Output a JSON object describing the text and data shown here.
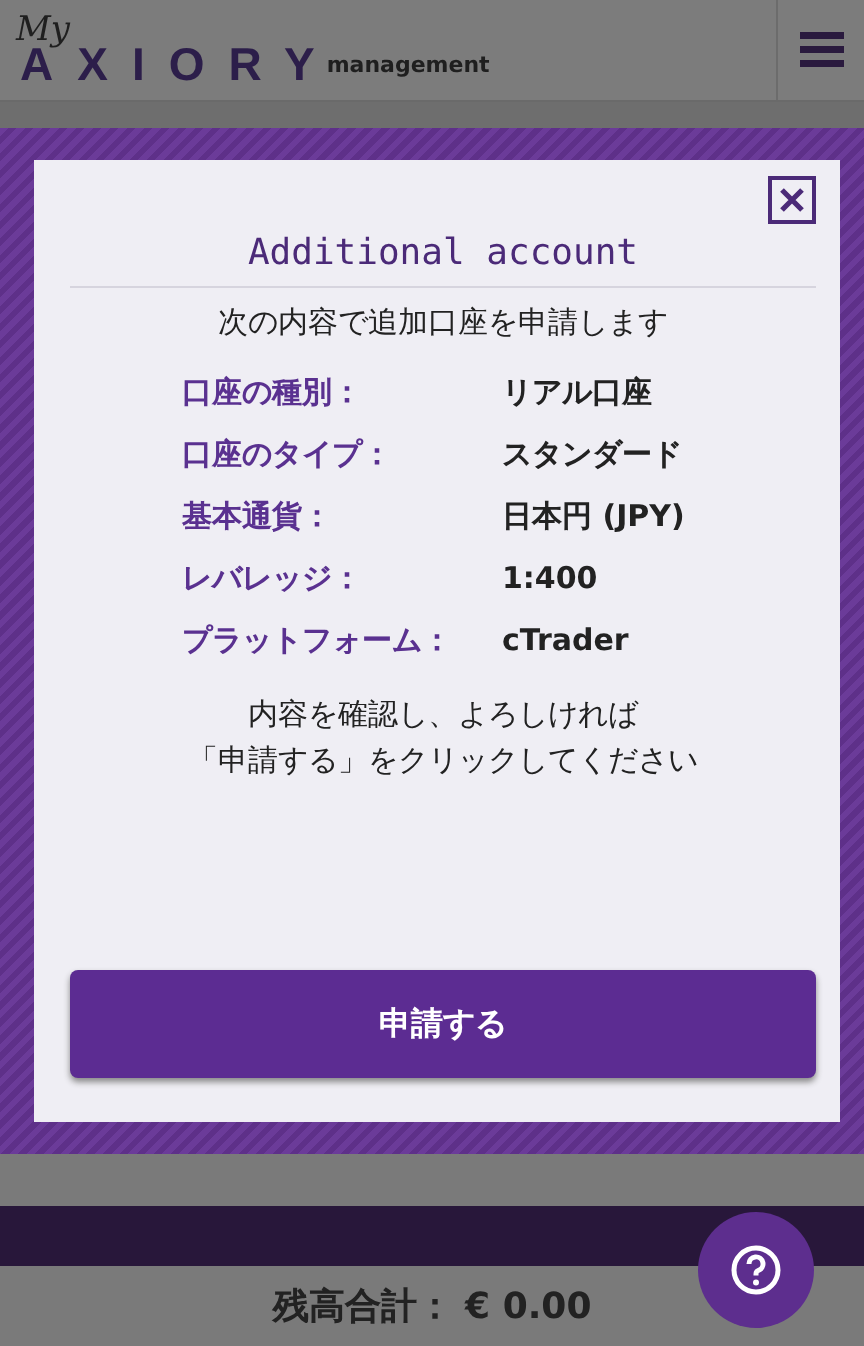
{
  "header": {
    "logo_prefix": "My",
    "logo": "AXIORY",
    "logo_suffix": "management"
  },
  "modal": {
    "title": "Additional account",
    "intro": "次の内容で追加口座を申請します",
    "fields": [
      {
        "label": "口座の種別：",
        "value": "リアル口座"
      },
      {
        "label": "口座のタイプ：",
        "value": "スタンダード"
      },
      {
        "label": "基本通貨：",
        "value": "日本円 (JPY)"
      },
      {
        "label": "レバレッジ：",
        "value": "1:400"
      },
      {
        "label": "プラットフォーム：",
        "value": "cTrader"
      }
    ],
    "note": [
      "内容を確認し、よろしければ",
      "「申請する」をクリックしてください"
    ],
    "submit": "申請する"
  },
  "footer": {
    "balance": "残高合計： € 0.00"
  }
}
